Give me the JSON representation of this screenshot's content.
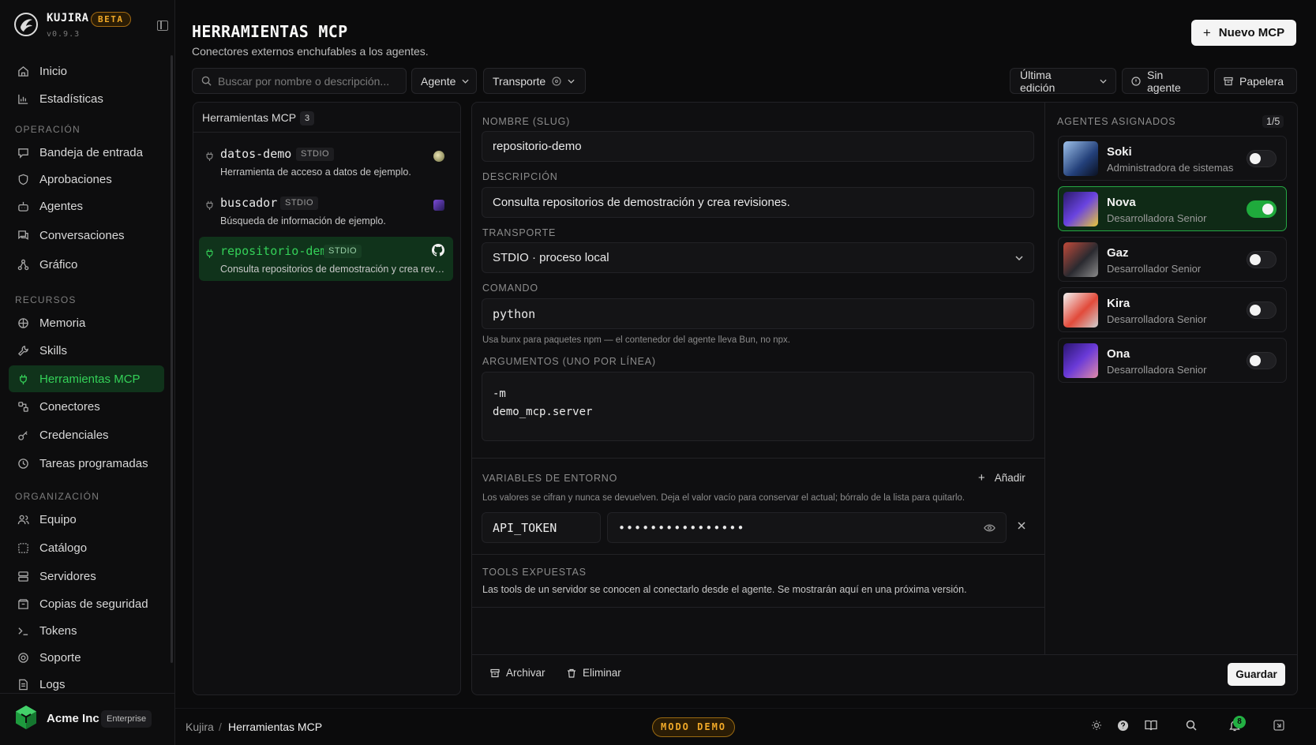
{
  "app": {
    "name": "KUJIRA",
    "badge": "BETA",
    "version": "v0.9.3"
  },
  "nav": {
    "top": [
      {
        "id": "inicio",
        "label": "Inicio",
        "icon": "home-icon"
      },
      {
        "id": "estadisticas",
        "label": "Estadísticas",
        "icon": "chart-icon"
      }
    ],
    "sections": [
      {
        "title": "OPERACIÓN",
        "items": [
          {
            "id": "bandeja",
            "label": "Bandeja de entrada",
            "icon": "inbox-icon"
          },
          {
            "id": "aprobaciones",
            "label": "Aprobaciones",
            "icon": "shield-icon"
          },
          {
            "id": "agentes",
            "label": "Agentes",
            "icon": "bot-icon"
          },
          {
            "id": "conversaciones",
            "label": "Conversaciones",
            "icon": "chat-icon"
          },
          {
            "id": "grafico",
            "label": "Gráfico",
            "icon": "graph-icon"
          }
        ]
      },
      {
        "title": "RECURSOS",
        "items": [
          {
            "id": "memoria",
            "label": "Memoria",
            "icon": "brain-icon"
          },
          {
            "id": "skills",
            "label": "Skills",
            "icon": "wrench-icon"
          },
          {
            "id": "mcp",
            "label": "Herramientas MCP",
            "icon": "plug-icon",
            "active": true
          },
          {
            "id": "conectores",
            "label": "Conectores",
            "icon": "connector-icon"
          },
          {
            "id": "credenciales",
            "label": "Credenciales",
            "icon": "key-icon"
          },
          {
            "id": "tareas",
            "label": "Tareas programadas",
            "icon": "clock-icon"
          }
        ]
      },
      {
        "title": "ORGANIZACIÓN",
        "items": [
          {
            "id": "equipo",
            "label": "Equipo",
            "icon": "users-icon"
          },
          {
            "id": "catalogo",
            "label": "Catálogo",
            "icon": "catalog-icon"
          },
          {
            "id": "servidores",
            "label": "Servidores",
            "icon": "server-icon"
          },
          {
            "id": "copias",
            "label": "Copias de seguridad",
            "icon": "backup-icon"
          },
          {
            "id": "tokens",
            "label": "Tokens",
            "icon": "terminal-icon"
          },
          {
            "id": "soporte",
            "label": "Soporte",
            "icon": "lifebuoy-icon"
          },
          {
            "id": "logs",
            "label": "Logs",
            "icon": "file-icon"
          }
        ]
      }
    ]
  },
  "org": {
    "name": "Acme Inc",
    "plan": "Enterprise"
  },
  "page": {
    "title": "HERRAMIENTAS MCP",
    "subtitle": "Conectores externos enchufables a los agentes.",
    "new_button": "Nuevo MCP"
  },
  "filters": {
    "search_placeholder": "Buscar por nombre o descripción...",
    "agent": "Agente",
    "transport": "Transporte",
    "sort": "Última edición",
    "no_agent": "Sin agente",
    "trash": "Papelera"
  },
  "list": {
    "title": "Herramientas MCP",
    "count": "3",
    "items": [
      {
        "name": "datos-demo",
        "tag": "STDIO",
        "desc": "Herramienta de acceso a datos de ejemplo."
      },
      {
        "name": "buscador",
        "tag": "STDIO",
        "desc": "Búsqueda de información de ejemplo."
      },
      {
        "name": "repositorio-demo",
        "tag": "STDIO",
        "desc": "Consulta repositorios de demostración y crea revisiones."
      }
    ]
  },
  "form": {
    "name_label": "NOMBRE (SLUG)",
    "name_value": "repositorio-demo",
    "desc_label": "DESCRIPCIÓN",
    "desc_value": "Consulta repositorios de demostración y crea revisiones.",
    "transport_label": "TRANSPORTE",
    "transport_value": "STDIO · proceso local",
    "command_label": "COMANDO",
    "command_value": "python",
    "command_hint": "Usa bunx para paquetes npm — el contenedor del agente lleva Bun, no npx.",
    "args_label": "ARGUMENTOS (UNO POR LÍNEA)",
    "args": [
      "-m",
      "demo_mcp.server"
    ],
    "env_label": "VARIABLES DE ENTORNO",
    "env_add": "Añadir",
    "env_hint": "Los valores se cifran y nunca se devuelven. Deja el valor vacío para conservar el actual; bórralo de la lista para quitarlo.",
    "env_key": "API_TOKEN",
    "env_value_masked": "••••••••••••••••",
    "tools_label": "TOOLS EXPUESTAS",
    "tools_text": "Las tools de un servidor se conocen al conectarlo desde el agente. Se mostrarán aquí en una próxima versión.",
    "archive": "Archivar",
    "delete": "Eliminar",
    "save": "Guardar"
  },
  "agents": {
    "title": "AGENTES ASIGNADOS",
    "count": "1/5",
    "items": [
      {
        "name": "Soki",
        "role": "Administradora de sistemas",
        "enabled": false,
        "color": "#3d6fb5"
      },
      {
        "name": "Nova",
        "role": "Desarrolladora Senior",
        "enabled": true,
        "color": "#5a37c9"
      },
      {
        "name": "Gaz",
        "role": "Desarrollador Senior",
        "enabled": false,
        "color": "#6e3a2c"
      },
      {
        "name": "Kira",
        "role": "Desarrolladora Senior",
        "enabled": false,
        "color": "#d8d8d8"
      },
      {
        "name": "Ona",
        "role": "Desarrolladora Senior",
        "enabled": false,
        "color": "#4b2fa6"
      }
    ]
  },
  "footer": {
    "crumb_root": "Kujira",
    "crumb_sep": "/",
    "crumb_current": "Herramientas MCP",
    "mode": "MODO DEMO",
    "notifications": "8"
  },
  "colors": {
    "accent": "#34d058",
    "active_bg": "#10331b",
    "demo": "#f0a928"
  }
}
